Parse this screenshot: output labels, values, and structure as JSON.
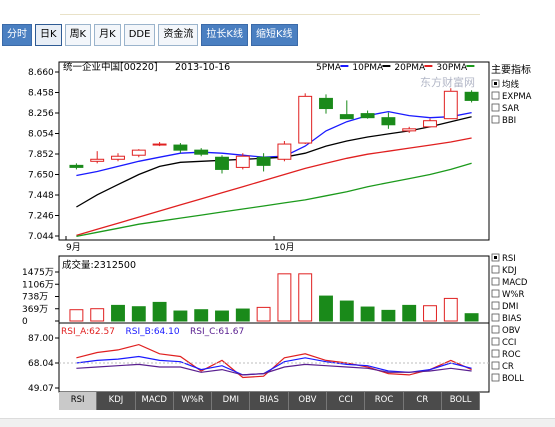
{
  "tabs": [
    {
      "label": "分时",
      "style": "blue"
    },
    {
      "label": "日K",
      "style": "active"
    },
    {
      "label": "周K",
      "style": "normal"
    },
    {
      "label": "月K",
      "style": "normal"
    },
    {
      "label": "DDE",
      "style": "normal"
    },
    {
      "label": "资金流",
      "style": "normal"
    },
    {
      "label": "拉长K线",
      "style": "blue"
    },
    {
      "label": "缩短K线",
      "style": "blue"
    }
  ],
  "header": {
    "stock_title": "统一企业中国[00220]",
    "date": "2013-10-16",
    "ma": [
      {
        "label": "5PMA",
        "color": "#1a1aff"
      },
      {
        "label": "10PMA",
        "color": "#000000"
      },
      {
        "label": "20PMA",
        "color": "#e02020"
      },
      {
        "label": "30PMA",
        "color": "#1c9a1c"
      }
    ],
    "watermark": "东方财富网"
  },
  "indicators_panel": {
    "title": "主要指标",
    "items": [
      {
        "label": "均线",
        "checked": true
      },
      {
        "label": "EXPMA",
        "checked": false
      },
      {
        "label": "SAR",
        "checked": false
      },
      {
        "label": "BBI",
        "checked": false
      }
    ]
  },
  "sub_indicators": [
    {
      "label": "RSI",
      "checked": true
    },
    {
      "label": "KDJ",
      "checked": false
    },
    {
      "label": "MACD",
      "checked": false
    },
    {
      "label": "W%R",
      "checked": false
    },
    {
      "label": "DMI",
      "checked": false
    },
    {
      "label": "BIAS",
      "checked": false
    },
    {
      "label": "OBV",
      "checked": false
    },
    {
      "label": "CCI",
      "checked": false
    },
    {
      "label": "ROC",
      "checked": false
    },
    {
      "label": "CR",
      "checked": false
    },
    {
      "label": "BOLL",
      "checked": false
    }
  ],
  "bottom_tabs": [
    "RSI",
    "KDJ",
    "MACD",
    "W%R",
    "DMI",
    "BIAS",
    "OBV",
    "CCI",
    "ROC",
    "CR",
    "BOLL"
  ],
  "chart_data": [
    {
      "type": "candlestick",
      "ylim": [
        7.044,
        8.66
      ],
      "yticks": [
        "8.660",
        "8.458",
        "8.256",
        "8.054",
        "7.852",
        "7.650",
        "7.448",
        "7.246",
        "7.044"
      ],
      "xticks": [
        {
          "label": "9月",
          "index": 0
        },
        {
          "label": "10月",
          "index": 10
        }
      ],
      "candles": [
        {
          "o": 7.74,
          "h": 7.76,
          "l": 7.7,
          "c": 7.72
        },
        {
          "o": 7.78,
          "h": 7.88,
          "l": 7.76,
          "c": 7.8
        },
        {
          "o": 7.8,
          "h": 7.86,
          "l": 7.78,
          "c": 7.83
        },
        {
          "o": 7.84,
          "h": 7.9,
          "l": 7.82,
          "c": 7.89
        },
        {
          "o": 7.95,
          "h": 7.97,
          "l": 7.93,
          "c": 7.95
        },
        {
          "o": 7.94,
          "h": 7.96,
          "l": 7.86,
          "c": 7.89
        },
        {
          "o": 7.89,
          "h": 7.91,
          "l": 7.83,
          "c": 7.85
        },
        {
          "o": 7.82,
          "h": 7.84,
          "l": 7.66,
          "c": 7.7
        },
        {
          "o": 7.72,
          "h": 7.86,
          "l": 7.7,
          "c": 7.83
        },
        {
          "o": 7.82,
          "h": 7.86,
          "l": 7.68,
          "c": 7.74
        },
        {
          "o": 7.8,
          "h": 7.98,
          "l": 7.78,
          "c": 7.95
        },
        {
          "o": 7.96,
          "h": 8.45,
          "l": 7.95,
          "c": 8.42
        },
        {
          "o": 8.4,
          "h": 8.44,
          "l": 8.25,
          "c": 8.3
        },
        {
          "o": 8.24,
          "h": 8.38,
          "l": 8.2,
          "c": 8.2
        },
        {
          "o": 8.25,
          "h": 8.28,
          "l": 8.2,
          "c": 8.21
        },
        {
          "o": 8.21,
          "h": 8.26,
          "l": 8.1,
          "c": 8.14
        },
        {
          "o": 8.08,
          "h": 8.12,
          "l": 8.06,
          "c": 8.1
        },
        {
          "o": 8.12,
          "h": 8.2,
          "l": 8.12,
          "c": 8.18
        },
        {
          "o": 8.2,
          "h": 8.5,
          "l": 8.2,
          "c": 8.47
        },
        {
          "o": 8.46,
          "h": 8.48,
          "l": 8.36,
          "c": 8.38
        }
      ],
      "series": [
        {
          "name": "5PMA",
          "values": [
            7.64,
            7.68,
            7.73,
            7.78,
            7.82,
            7.86,
            7.87,
            7.86,
            7.84,
            7.82,
            7.83,
            7.93,
            8.08,
            8.17,
            8.23,
            8.27,
            8.23,
            8.21,
            8.22,
            8.26
          ]
        },
        {
          "name": "10PMA",
          "values": [
            7.33,
            7.45,
            7.55,
            7.65,
            7.73,
            7.77,
            7.78,
            7.79,
            7.8,
            7.81,
            7.82,
            7.86,
            7.93,
            7.98,
            8.02,
            8.05,
            8.08,
            8.12,
            8.17,
            8.22
          ]
        },
        {
          "name": "20PMA",
          "values": [
            7.05,
            7.11,
            7.17,
            7.23,
            7.29,
            7.35,
            7.41,
            7.47,
            7.53,
            7.59,
            7.65,
            7.71,
            7.76,
            7.81,
            7.85,
            7.88,
            7.91,
            7.94,
            7.97,
            8.01
          ]
        },
        {
          "name": "30PMA",
          "values": [
            7.04,
            7.08,
            7.12,
            7.16,
            7.19,
            7.22,
            7.25,
            7.28,
            7.31,
            7.34,
            7.37,
            7.4,
            7.44,
            7.48,
            7.53,
            7.57,
            7.61,
            7.65,
            7.7,
            7.76
          ]
        }
      ]
    },
    {
      "type": "bar",
      "title": "成交量:2312500",
      "ylim": [
        0,
        1475
      ],
      "yticks": [
        "1475万",
        "1106万",
        "738万",
        "369万",
        "0"
      ],
      "values": [
        340,
        370,
        470,
        430,
        560,
        300,
        340,
        300,
        360,
        410,
        1420,
        1420,
        750,
        600,
        420,
        320,
        470,
        460,
        680,
        220
      ],
      "up": [
        false,
        false,
        true,
        true,
        true,
        true,
        true,
        true,
        true,
        false,
        false,
        false,
        true,
        true,
        true,
        true,
        true,
        false,
        false,
        true
      ]
    },
    {
      "type": "line",
      "ylim": [
        49.07,
        87.0
      ],
      "yticks": [
        "87.00",
        "68.04",
        "49.07"
      ],
      "series": [
        {
          "name": "RSI_A",
          "label": "RSI_A:62.57",
          "color": "#e02020",
          "values": [
            72,
            76,
            78,
            82,
            75,
            73,
            62,
            70,
            57,
            58,
            72,
            75,
            70,
            68,
            65,
            60,
            59,
            63,
            70,
            63
          ]
        },
        {
          "name": "RSI_B",
          "label": "RSI_B:64.10",
          "color": "#1a1aff",
          "values": [
            68,
            70,
            71,
            73,
            70,
            69,
            63,
            66,
            59,
            60,
            69,
            72,
            69,
            67,
            66,
            62,
            61,
            63,
            68,
            64
          ]
        },
        {
          "name": "RSI_C",
          "label": "RSI_C:61.67",
          "color": "#5a2090",
          "values": [
            64,
            65,
            66,
            67,
            65,
            65,
            61,
            63,
            59,
            60,
            65,
            67,
            66,
            65,
            64,
            61,
            61,
            62,
            64,
            62
          ]
        }
      ]
    }
  ]
}
